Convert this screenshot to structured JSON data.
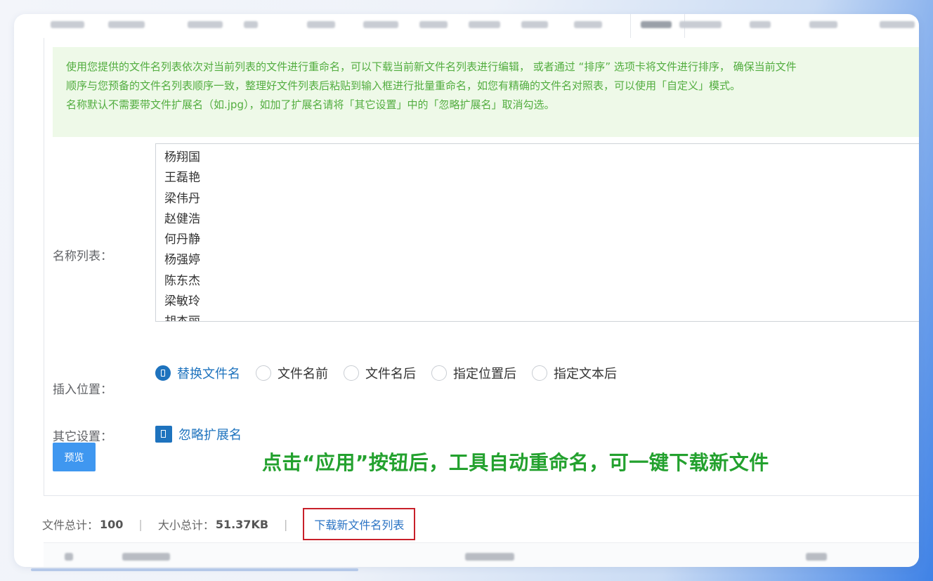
{
  "notice": {
    "line1": "使用您提供的文件名列表依次对当前列表的文件进行重命名，可以下载当前新文件名列表进行编辑，  或者通过 “排序” 选项卡将文件进行排序，  确保当前文件",
    "line2": "顺序与您预备的文件名列表顺序一致，整理好文件列表后粘贴到输入框进行批量重命名，如您有精确的文件名对照表，可以使用「自定义」模式。",
    "line3": "名称默认不需要带文件扩展名（如.jpg），如加了扩展名请将「其它设置」中的「忽略扩展名」取消勾选。"
  },
  "name_list": {
    "label": "名称列表：",
    "names": [
      "杨翔国",
      "王磊艳",
      "梁伟丹",
      "赵健浩",
      "何丹静",
      "杨强婷",
      "陈东杰",
      "梁敏玲",
      "胡杰丽"
    ]
  },
  "insert_position": {
    "label": "插入位置：",
    "options": [
      {
        "label": "替换文件名",
        "checked": true
      },
      {
        "label": "文件名前",
        "checked": false
      },
      {
        "label": "文件名后",
        "checked": false
      },
      {
        "label": "指定位置后",
        "checked": false
      },
      {
        "label": "指定文本后",
        "checked": false
      }
    ]
  },
  "other_settings": {
    "label": "其它设置：",
    "ignore_extension_label": "忽略扩展名",
    "ignore_extension_checked": true
  },
  "preview_button": "预览",
  "annotation": "点击“应用”按钮后，工具自动重命名，可一键下载新文件",
  "stats": {
    "file_count_label": "文件总计：",
    "file_count": "100",
    "size_label": "大小总计：",
    "size_total": "51.37KB",
    "separator": "|",
    "download_link": "下载新文件名列表"
  },
  "colors": {
    "accent": "#1e73be",
    "notice_text": "#52ad3f",
    "notice_bg": "#eef9e8",
    "annotation": "#23a12e",
    "highlight_border": "#c8202a",
    "button": "#3f97f0"
  }
}
